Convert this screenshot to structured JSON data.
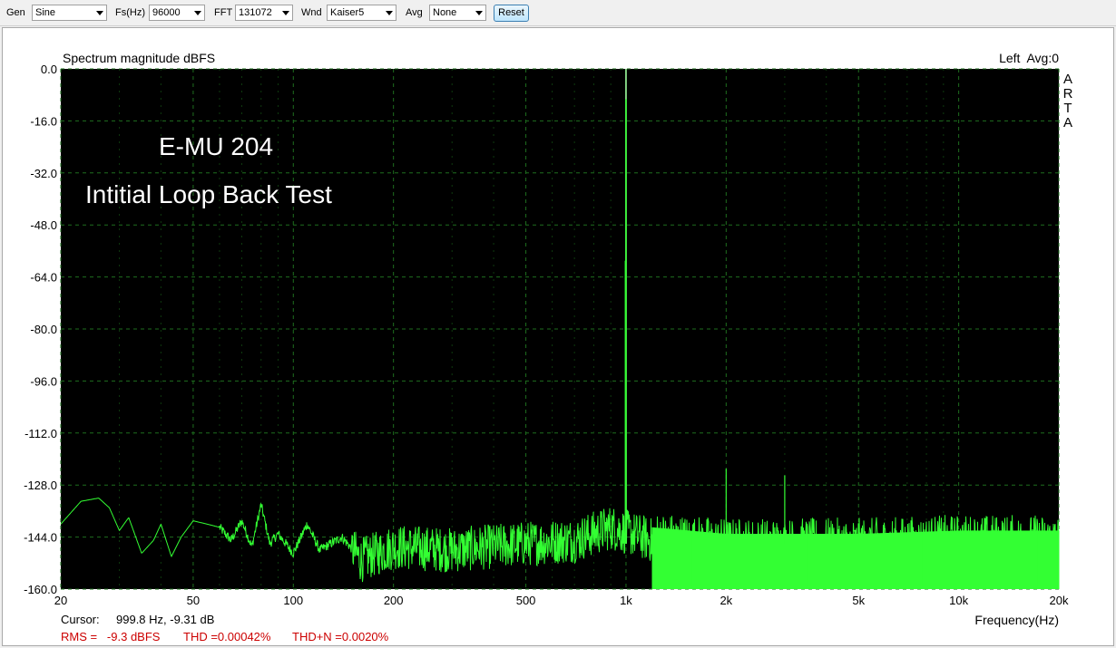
{
  "toolbar": {
    "gen_label": "Gen",
    "gen_value": "Sine",
    "fs_label": "Fs(Hz)",
    "fs_value": "96000",
    "fft_label": "FFT",
    "fft_value": "131072",
    "wnd_label": "Wnd",
    "wnd_value": "Kaiser5",
    "avg_label": "Avg",
    "avg_value": "None",
    "reset_label": "Reset"
  },
  "header": {
    "title": "Spectrum magnitude dBFS",
    "channel": "Left  Avg:0",
    "watermark": [
      "A",
      "R",
      "T",
      "A"
    ]
  },
  "annotation": {
    "line1": "E-MU 204",
    "line2": "Intitial Loop Back Test"
  },
  "footer": {
    "cursor_label": "Cursor:",
    "cursor_value": "999.8 Hz, -9.31 dB",
    "rms": "RMS =   -9.3 dBFS",
    "thd": "THD =0.00042%",
    "thdn": "THD+N =0.0020%"
  },
  "colors": {
    "plot_bg": "#000000",
    "grid": "#1e6e1e",
    "trace": "#33ff33",
    "stats_text": "#cc0000"
  },
  "chart_data": {
    "type": "line",
    "title": "Spectrum magnitude dBFS",
    "xlabel": "Frequency(Hz)",
    "ylabel": "",
    "xscale": "log",
    "xlim": [
      20,
      20000
    ],
    "ylim": [
      -160,
      0
    ],
    "grid": true,
    "y_ticks": [
      0,
      -16,
      -32,
      -48,
      -64,
      -80,
      -96,
      -112,
      -128,
      -144,
      -160
    ],
    "y_tick_labels": [
      "0.0",
      "-16.0",
      "-32.0",
      "-48.0",
      "-64.0",
      "-80.0",
      "-96.0",
      "-112.0",
      "-128.0",
      "-144.0",
      "-160.0"
    ],
    "x_ticks": [
      20,
      50,
      100,
      200,
      500,
      1000,
      2000,
      5000,
      10000,
      20000
    ],
    "x_tick_labels": [
      "20",
      "50",
      "100",
      "200",
      "500",
      "1k",
      "2k",
      "5k",
      "10k",
      "20k"
    ],
    "noise_floor": {
      "x": [
        20,
        23,
        26,
        28,
        30,
        32,
        35,
        38,
        40,
        43,
        46,
        50,
        55,
        60,
        65,
        70,
        75,
        80,
        85,
        90,
        100,
        110,
        120,
        140,
        160,
        200,
        300,
        500,
        700,
        900,
        1200,
        2000,
        5000,
        10000,
        20000
      ],
      "y": [
        -140,
        -133,
        -132,
        -135,
        -142,
        -138,
        -149,
        -145,
        -140,
        -150,
        -144,
        -139,
        -140,
        -141,
        -145,
        -139,
        -147,
        -134,
        -146,
        -143,
        -149,
        -140,
        -148,
        -144,
        -151,
        -147,
        -148,
        -146,
        -145,
        -141,
        -145,
        -147,
        -147,
        -146,
        -146
      ]
    },
    "peaks": [
      {
        "x": 1000,
        "y": 0
      },
      {
        "x": 1000,
        "y": -9.3
      },
      {
        "x": 995,
        "y": -59
      },
      {
        "x": 2000,
        "y": -123
      },
      {
        "x": 3000,
        "y": -125
      }
    ]
  }
}
